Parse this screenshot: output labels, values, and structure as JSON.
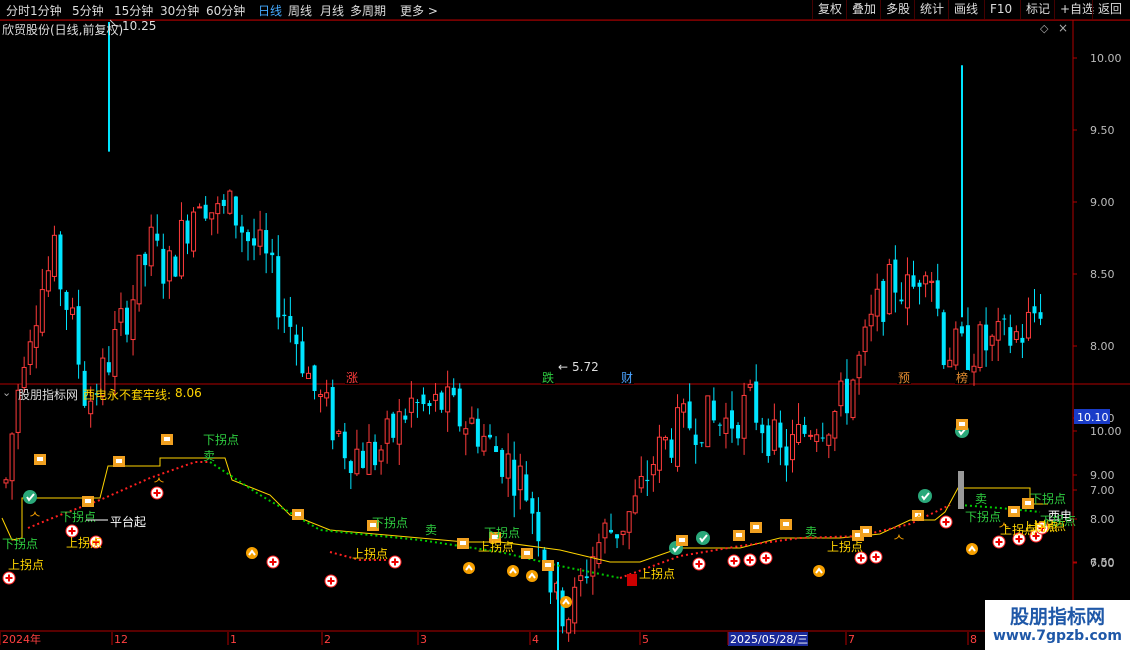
{
  "toolbar": {
    "left": [
      "分时",
      "1分钟",
      "5分钟",
      "15分钟",
      "30分钟",
      "60分钟",
      "日线",
      "周线",
      "月线",
      "多周期",
      "更多 >"
    ],
    "active": "日线",
    "right": [
      "复权",
      "叠加",
      "多股",
      "统计",
      "画线",
      "F10",
      "标记",
      "+自选",
      "返回"
    ]
  },
  "main_panel": {
    "title": "欣贸股份(日线,前复权)",
    "high_label": "10.25",
    "low_label": "5.72",
    "y_ticks": [
      "10.00",
      "9.50",
      "9.00",
      "8.50",
      "8.00",
      "7.50",
      "7.00",
      "6.50",
      "6.00"
    ],
    "event_tags": [
      {
        "text": "涨",
        "color": "#ff3b3b"
      },
      {
        "text": "跌",
        "color": "#2ecc40"
      },
      {
        "text": "财",
        "color": "#4aa3ff"
      },
      {
        "text": "预",
        "color": "#e08a2e"
      },
      {
        "text": "榜",
        "color": "#e08a2e"
      }
    ]
  },
  "indicator_panel": {
    "title": "股朋指标网",
    "line_name": "西电永不套牢线:",
    "line_value": "8.06",
    "current_price_tag": "10.10",
    "y_ticks": [
      "10.00",
      "9.00",
      "8.00",
      "7.00"
    ],
    "annotations": [
      "下拐点",
      "上拐点",
      "下拐点",
      "上拐点",
      "平台起",
      "下拐点",
      "卖",
      "下拐点",
      "上拐点",
      "卖",
      "下拐点",
      "上拐点",
      "上拐点",
      "上拐点",
      "卖",
      "下拐点",
      "上拐点",
      "上拐点",
      "卖",
      "下拐点",
      "西电",
      "下拐点",
      "上拐点"
    ]
  },
  "time_axis": {
    "labels": [
      "2024年",
      "12",
      "1",
      "2",
      "3",
      "4",
      "5",
      "2025/05/28/三",
      "7",
      "8"
    ]
  },
  "watermark": {
    "title": "股朋指标网",
    "url": "www.7gpzb.com"
  },
  "colors": {
    "up": "#ff3b3b",
    "down": "#00e5ff",
    "line_yellow": "#ffd400",
    "line_red_dots": "#ff2020",
    "line_green_dots": "#00c800",
    "axis_border": "#b00000",
    "price_label": "#bbbbbb"
  },
  "chart_data": {
    "type": "candlestick",
    "description_units": "price (CNY)",
    "y_range": [
      5.6,
      10.3
    ],
    "high": 10.25,
    "low": 5.72,
    "close_sequence": [
      7.05,
      7.95,
      8.35,
      8.6,
      8.2,
      7.6,
      7.8,
      8.1,
      8.4,
      8.7,
      8.5,
      8.8,
      9.1,
      8.9,
      8.95,
      8.75,
      8.6,
      8.3,
      8.05,
      7.7,
      7.5,
      7.3,
      7.25,
      7.25,
      7.4,
      7.6,
      7.55,
      7.6,
      7.5,
      7.45,
      7.3,
      7.2,
      7.05,
      6.75,
      6.2,
      6.15,
      6.5,
      6.7,
      6.75,
      6.9,
      7.2,
      7.35,
      7.45,
      7.5,
      7.45,
      7.5,
      7.6,
      7.45,
      7.2,
      7.35,
      7.5,
      7.5,
      7.65,
      7.95,
      8.3,
      8.45,
      8.35,
      8.7,
      8.0,
      7.95,
      8.0,
      8.0,
      8.05,
      8.1,
      8.3
    ],
    "indicator_name": "西电永不套牢线",
    "indicator_value": 8.06
  }
}
